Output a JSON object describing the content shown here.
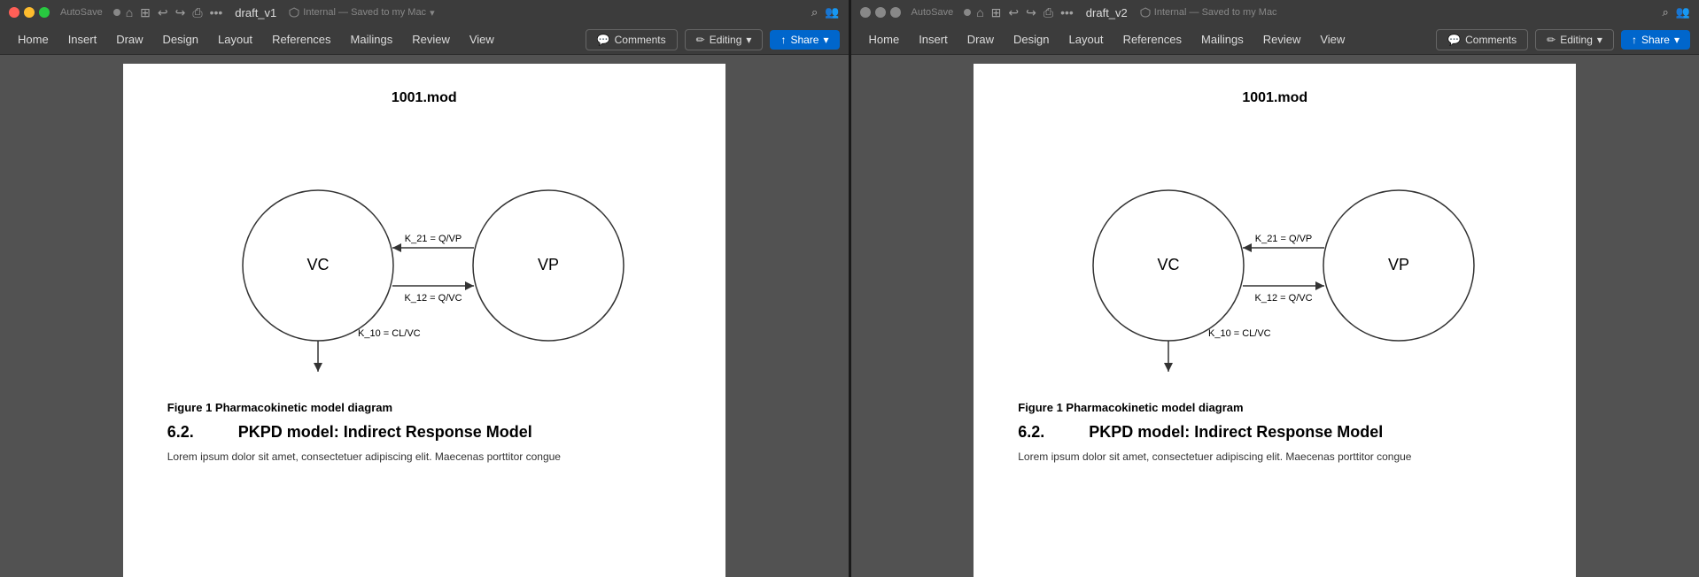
{
  "windows": [
    {
      "id": "window1",
      "titleBar": {
        "autosave": "AutoSave",
        "filename": "draft_v1",
        "status": "Internal — Saved to my Mac",
        "statusArrow": "▾"
      },
      "menuItems": [
        "Home",
        "Insert",
        "Draw",
        "Design",
        "Layout",
        "References",
        "Mailings",
        "Review",
        "View"
      ],
      "toolbar": {
        "comments_label": "Comments",
        "editing_label": "Editing",
        "share_label": "Share"
      },
      "document": {
        "title": "1001.mod",
        "diagram": {
          "vc_label": "VC",
          "vp_label": "VP",
          "k21_label": "K_21 = Q/VP",
          "k12_label": "K_12 = Q/VC",
          "k10_label": "K_10 = CL/VC"
        },
        "figureCaption": "Figure 1 Pharmacokinetic model diagram",
        "sectionNumber": "6.2.",
        "sectionTitle": "PKPD model: Indirect Response Model",
        "bodyText": "Lorem ipsum dolor sit amet, consectetuer adipiscing elit. Maecenas porttitor congue"
      }
    },
    {
      "id": "window2",
      "titleBar": {
        "autosave": "AutoSave",
        "filename": "draft_v2",
        "status": "Internal — Saved to my Mac",
        "statusArrow": "▾"
      },
      "menuItems": [
        "Home",
        "Insert",
        "Draw",
        "Design",
        "Layout",
        "References",
        "Mailings",
        "Review",
        "View"
      ],
      "toolbar": {
        "comments_label": "Comments",
        "editing_label": "Editing",
        "share_label": "Share"
      },
      "document": {
        "title": "1001.mod",
        "diagram": {
          "vc_label": "VC",
          "vp_label": "VP",
          "k21_label": "K_21 = Q/VP",
          "k12_label": "K_12 = Q/VC",
          "k10_label": "K_10 = CL/VC"
        },
        "figureCaption": "Figure 1 Pharmacokinetic model diagram",
        "sectionNumber": "6.2.",
        "sectionTitle": "PKPD model: Indirect Response Model",
        "bodyText": "Lorem ipsum dolor sit amet, consectetuer adipiscing elit. Maecenas porttitor congue"
      }
    }
  ],
  "icons": {
    "comments_icon": "💬",
    "pencil_icon": "✏",
    "share_icon": "↑",
    "home_icon": "⌂",
    "search_icon": "⌕",
    "people_icon": "👥",
    "back_icon": "←",
    "forward_icon": "→",
    "undo_icon": "↩",
    "redo_icon": "↪",
    "print_icon": "⎙",
    "more_icon": "•••"
  }
}
